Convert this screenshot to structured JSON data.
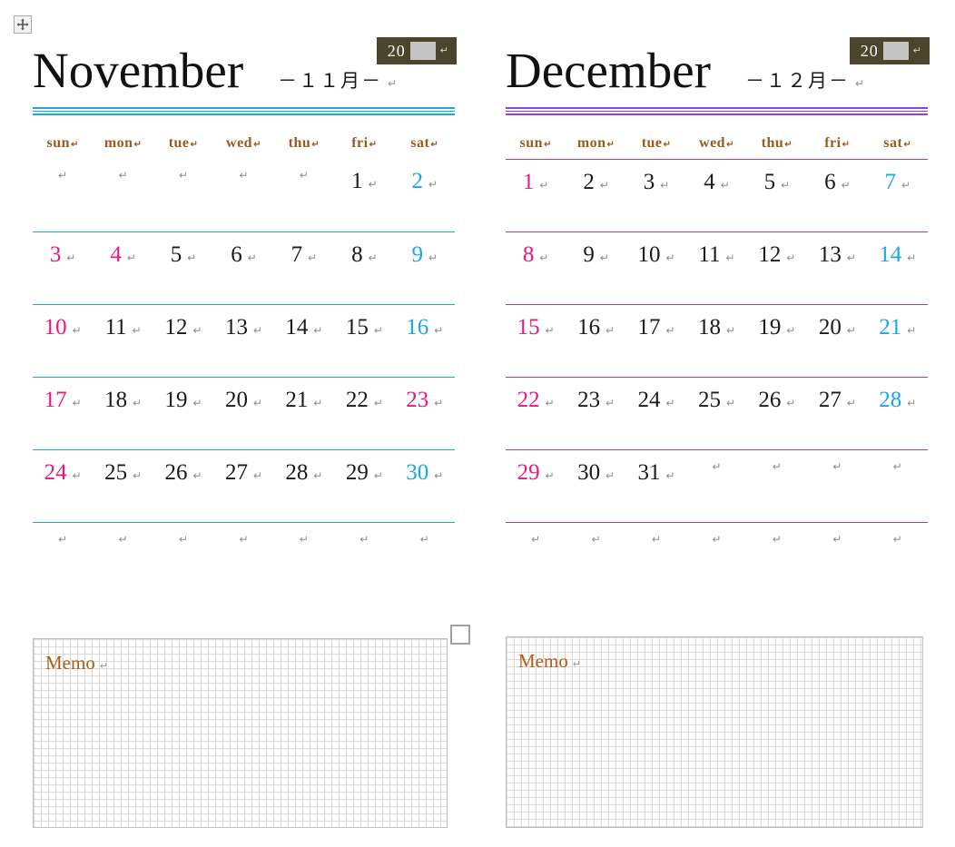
{
  "document": {
    "move_handle_icon": "move-four-way-arrow-icon",
    "anchor_square_icon": "selection-anchor-square-icon",
    "pilcrow": "↵"
  },
  "colors": {
    "sunday": "#e8197d",
    "saturday": "#19a8e0",
    "holiday": "#e8197d",
    "weekday_header": "#9b5a1e",
    "memo_label": "#b35c12",
    "year_badge_bg": "#4b452c",
    "november_rule": "#19a8e0",
    "december_rule": "#8d3fe8"
  },
  "weekdays": [
    "sun",
    "mon",
    "tue",
    "wed",
    "thu",
    "fri",
    "sat"
  ],
  "months": [
    {
      "key": "november",
      "name": "November",
      "jp": "－１１月－",
      "year_prefix": "20",
      "year_field_value": "",
      "rule_color": "#19a8e0",
      "memo_label": "Memo",
      "weeks": [
        [
          {
            "d": "",
            "t": "empty"
          },
          {
            "d": "",
            "t": "empty"
          },
          {
            "d": "",
            "t": "empty"
          },
          {
            "d": "",
            "t": "empty"
          },
          {
            "d": "",
            "t": "empty"
          },
          {
            "d": "1",
            "t": "normal"
          },
          {
            "d": "2",
            "t": "sat"
          }
        ],
        [
          {
            "d": "3",
            "t": "sun"
          },
          {
            "d": "4",
            "t": "holiday"
          },
          {
            "d": "5",
            "t": "normal"
          },
          {
            "d": "6",
            "t": "normal"
          },
          {
            "d": "7",
            "t": "normal"
          },
          {
            "d": "8",
            "t": "normal"
          },
          {
            "d": "9",
            "t": "sat"
          }
        ],
        [
          {
            "d": "10",
            "t": "sun"
          },
          {
            "d": "11",
            "t": "normal"
          },
          {
            "d": "12",
            "t": "normal"
          },
          {
            "d": "13",
            "t": "normal"
          },
          {
            "d": "14",
            "t": "normal"
          },
          {
            "d": "15",
            "t": "normal"
          },
          {
            "d": "16",
            "t": "sat"
          }
        ],
        [
          {
            "d": "17",
            "t": "sun"
          },
          {
            "d": "18",
            "t": "normal"
          },
          {
            "d": "19",
            "t": "normal"
          },
          {
            "d": "20",
            "t": "normal"
          },
          {
            "d": "21",
            "t": "normal"
          },
          {
            "d": "22",
            "t": "normal"
          },
          {
            "d": "23",
            "t": "holiday"
          }
        ],
        [
          {
            "d": "24",
            "t": "sun"
          },
          {
            "d": "25",
            "t": "normal"
          },
          {
            "d": "26",
            "t": "normal"
          },
          {
            "d": "27",
            "t": "normal"
          },
          {
            "d": "28",
            "t": "normal"
          },
          {
            "d": "29",
            "t": "normal"
          },
          {
            "d": "30",
            "t": "sat"
          }
        ],
        [
          {
            "d": "",
            "t": "empty"
          },
          {
            "d": "",
            "t": "empty"
          },
          {
            "d": "",
            "t": "empty"
          },
          {
            "d": "",
            "t": "empty"
          },
          {
            "d": "",
            "t": "empty"
          },
          {
            "d": "",
            "t": "empty"
          },
          {
            "d": "",
            "t": "empty"
          }
        ]
      ]
    },
    {
      "key": "december",
      "name": "December",
      "jp": "－１２月－",
      "year_prefix": "20",
      "year_field_value": "",
      "rule_color": "#8d3fe8",
      "memo_label": "Memo",
      "weeks": [
        [
          {
            "d": "1",
            "t": "sun"
          },
          {
            "d": "2",
            "t": "normal"
          },
          {
            "d": "3",
            "t": "normal"
          },
          {
            "d": "4",
            "t": "normal"
          },
          {
            "d": "5",
            "t": "normal"
          },
          {
            "d": "6",
            "t": "normal"
          },
          {
            "d": "7",
            "t": "sat"
          }
        ],
        [
          {
            "d": "8",
            "t": "sun"
          },
          {
            "d": "9",
            "t": "normal"
          },
          {
            "d": "10",
            "t": "normal"
          },
          {
            "d": "11",
            "t": "normal"
          },
          {
            "d": "12",
            "t": "normal"
          },
          {
            "d": "13",
            "t": "normal"
          },
          {
            "d": "14",
            "t": "sat"
          }
        ],
        [
          {
            "d": "15",
            "t": "sun"
          },
          {
            "d": "16",
            "t": "normal"
          },
          {
            "d": "17",
            "t": "normal"
          },
          {
            "d": "18",
            "t": "normal"
          },
          {
            "d": "19",
            "t": "normal"
          },
          {
            "d": "20",
            "t": "normal"
          },
          {
            "d": "21",
            "t": "sat"
          }
        ],
        [
          {
            "d": "22",
            "t": "sun"
          },
          {
            "d": "23",
            "t": "normal"
          },
          {
            "d": "24",
            "t": "normal"
          },
          {
            "d": "25",
            "t": "normal"
          },
          {
            "d": "26",
            "t": "normal"
          },
          {
            "d": "27",
            "t": "normal"
          },
          {
            "d": "28",
            "t": "sat"
          }
        ],
        [
          {
            "d": "29",
            "t": "sun"
          },
          {
            "d": "30",
            "t": "normal"
          },
          {
            "d": "31",
            "t": "normal"
          },
          {
            "d": "",
            "t": "empty"
          },
          {
            "d": "",
            "t": "empty"
          },
          {
            "d": "",
            "t": "empty"
          },
          {
            "d": "",
            "t": "empty"
          }
        ],
        [
          {
            "d": "",
            "t": "empty"
          },
          {
            "d": "",
            "t": "empty"
          },
          {
            "d": "",
            "t": "empty"
          },
          {
            "d": "",
            "t": "empty"
          },
          {
            "d": "",
            "t": "empty"
          },
          {
            "d": "",
            "t": "empty"
          },
          {
            "d": "",
            "t": "empty"
          }
        ]
      ]
    }
  ]
}
